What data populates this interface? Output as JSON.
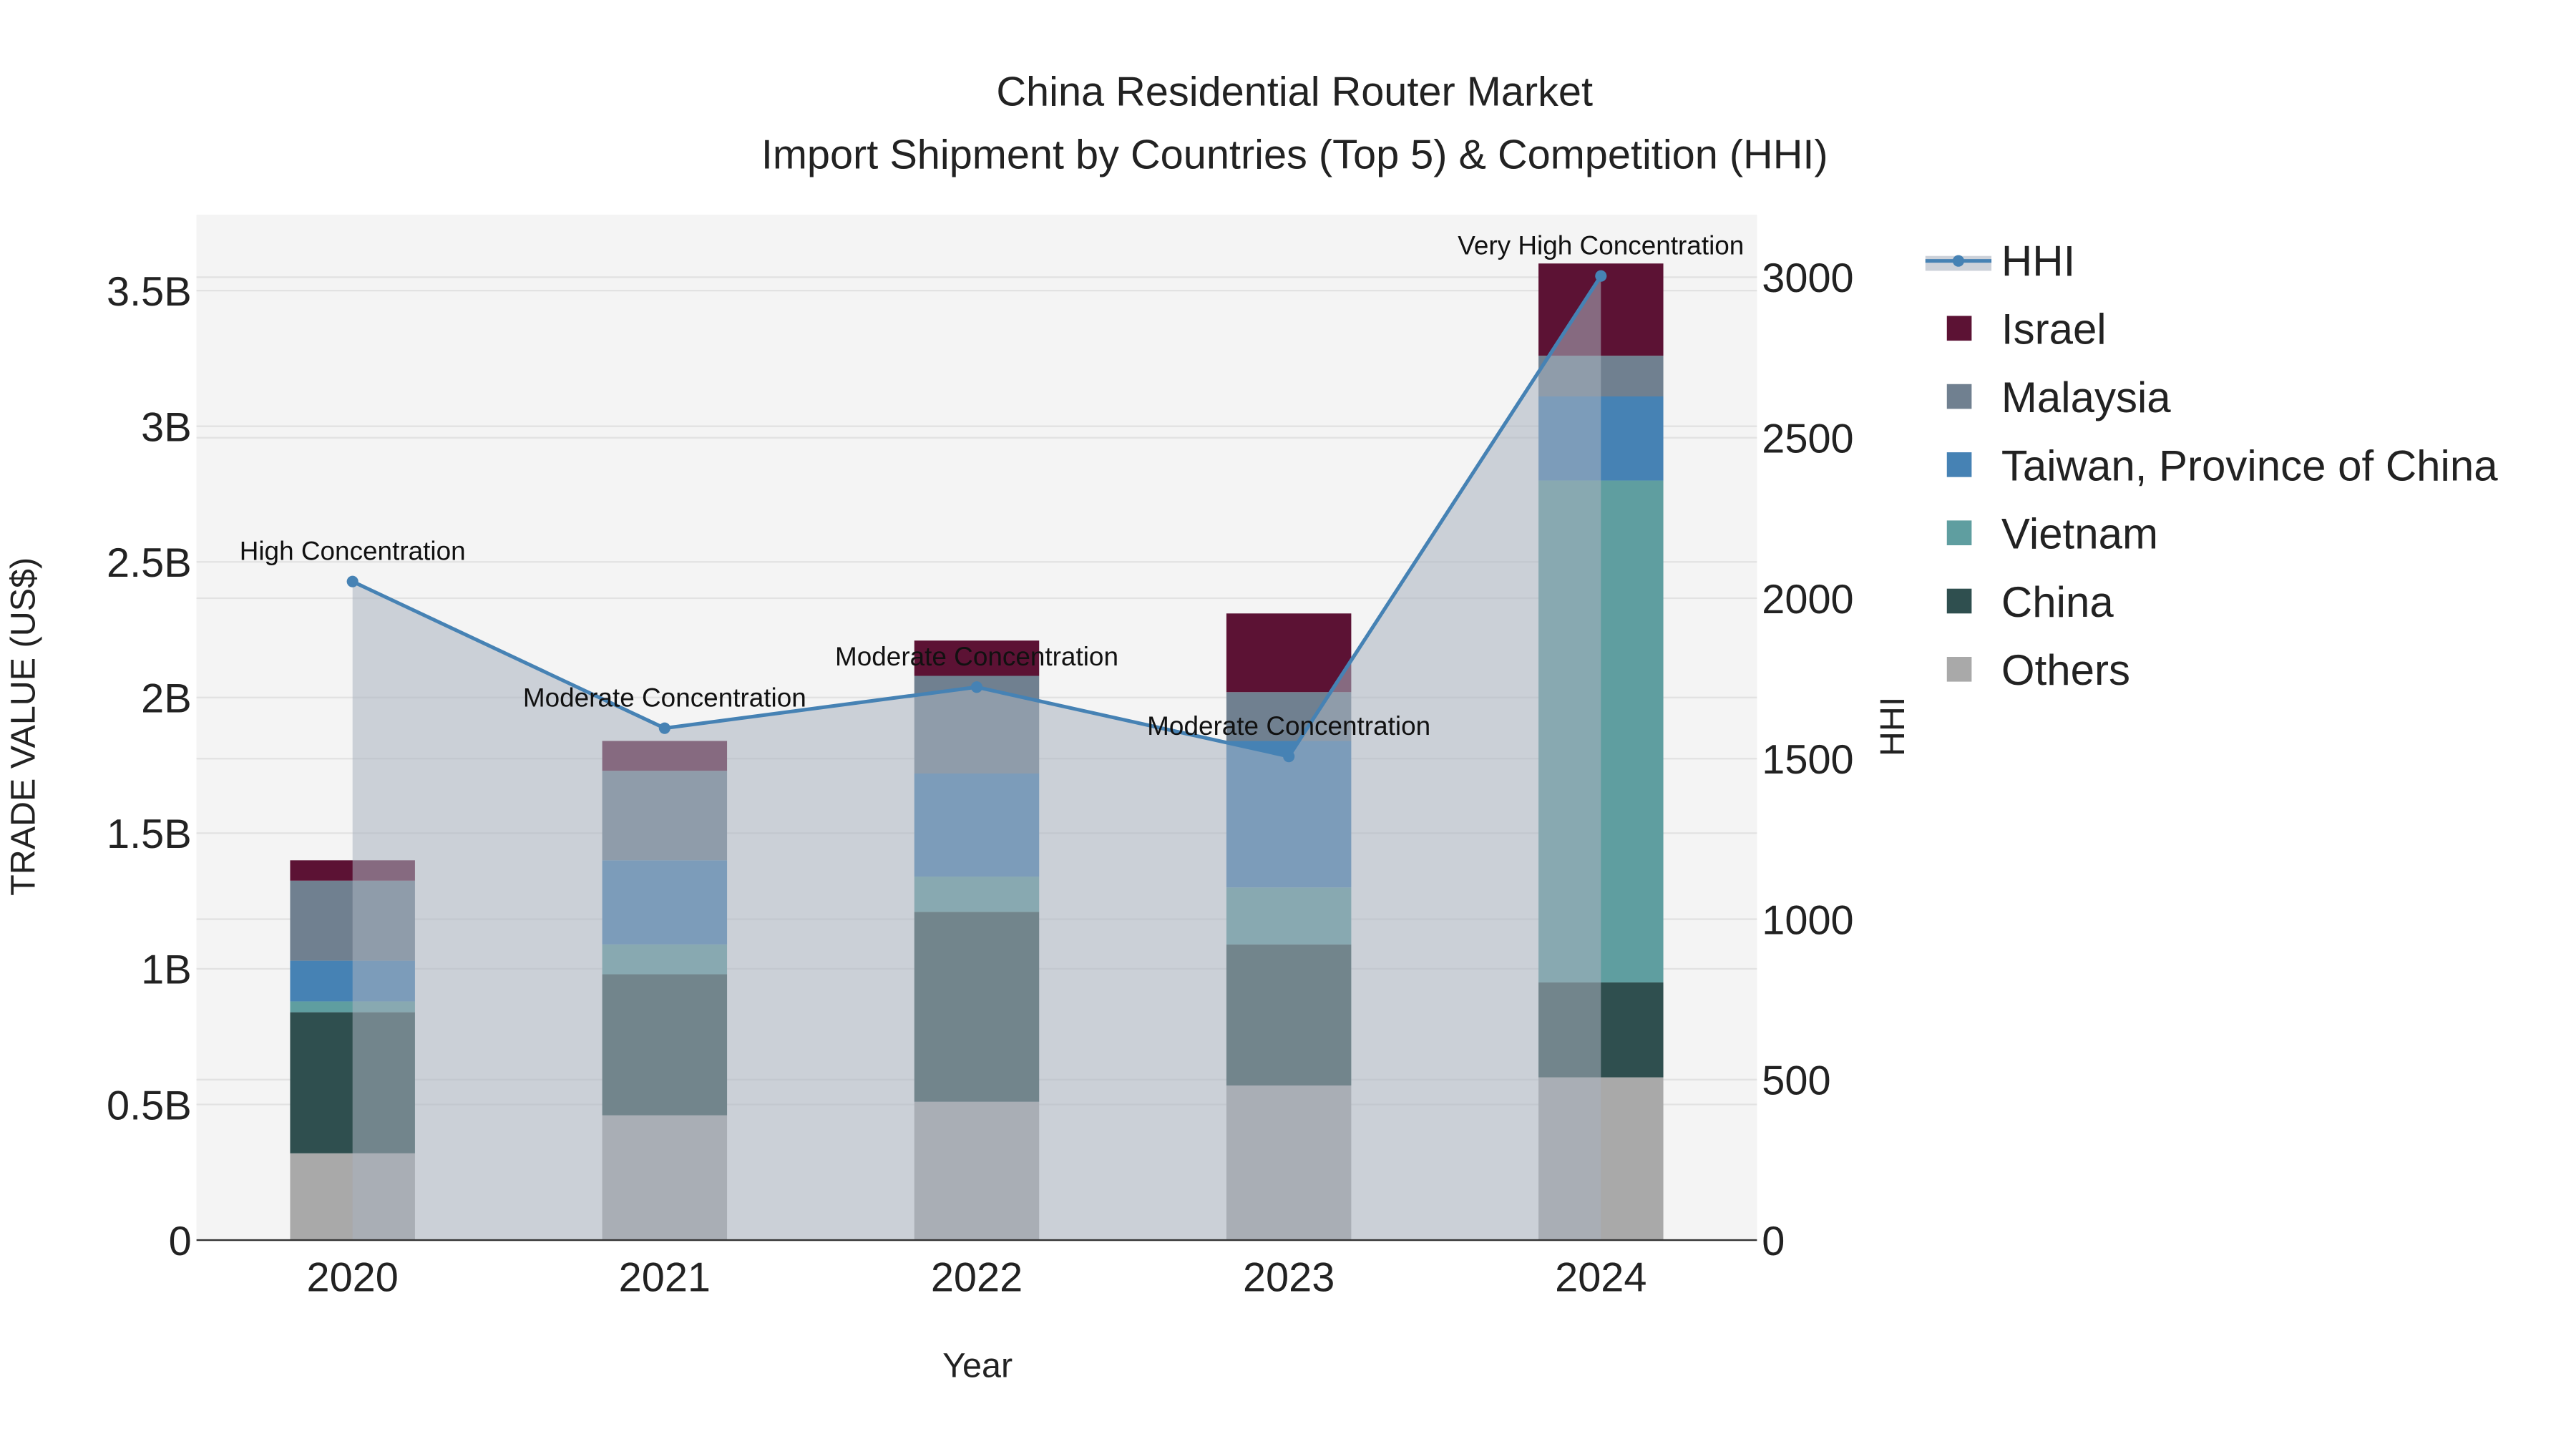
{
  "chart_data": {
    "type": "bar",
    "title_line1": "China Residential Router Market",
    "title_line2": "Import Shipment by Countries (Top 5) & Competition (HHI)",
    "xlabel": "Year",
    "ylabel": "TRADE VALUE (US$)",
    "y2label": "HHI",
    "categories": [
      "2020",
      "2021",
      "2022",
      "2023",
      "2024"
    ],
    "ylim": [
      0,
      3.78
    ],
    "y_ticks": [
      0,
      0.5,
      1,
      1.5,
      2,
      2.5,
      3,
      3.5
    ],
    "y_tick_labels": [
      "0",
      "0.5B",
      "1B",
      "1.5B",
      "2B",
      "2.5B",
      "3B",
      "3.5B"
    ],
    "y2lim": [
      0,
      3195
    ],
    "y2_ticks": [
      0,
      500,
      1000,
      1500,
      2000,
      2500,
      3000
    ],
    "y2_tick_labels": [
      "0",
      "500",
      "1000",
      "1500",
      "2000",
      "2500",
      "3000"
    ],
    "value_unit": "billion US$",
    "series": [
      {
        "name": "Others",
        "color": "#a9a9a9",
        "values": [
          0.32,
          0.46,
          0.51,
          0.57,
          0.6
        ]
      },
      {
        "name": "China",
        "color": "#2f4f4f",
        "values": [
          0.52,
          0.52,
          0.7,
          0.52,
          0.35
        ]
      },
      {
        "name": "Vietnam",
        "color": "#5f9ea0",
        "values": [
          0.04,
          0.11,
          0.13,
          0.21,
          1.85
        ]
      },
      {
        "name": "Taiwan, Province of China",
        "color": "#4682b4",
        "values": [
          0.15,
          0.31,
          0.38,
          0.54,
          0.31
        ]
      },
      {
        "name": "Malaysia",
        "color": "#708090",
        "values": [
          0.295,
          0.33,
          0.36,
          0.18,
          0.15
        ]
      },
      {
        "name": "Israel",
        "color": "#5c1234",
        "values": [
          0.075,
          0.11,
          0.13,
          0.29,
          0.34
        ]
      }
    ],
    "hhi": {
      "name": "HHI",
      "color": "#4682b4",
      "values": [
        2052,
        1595,
        1723,
        1507,
        3004
      ],
      "annotations": [
        "High Concentration",
        "Moderate Concentration",
        "Moderate Concentration",
        "Moderate Concentration",
        "Very High Concentration"
      ]
    },
    "legend": [
      "HHI",
      "Israel",
      "Malaysia",
      "Taiwan, Province of China",
      "Vietnam",
      "China",
      "Others"
    ],
    "legend_placement": "right",
    "grid": true
  }
}
